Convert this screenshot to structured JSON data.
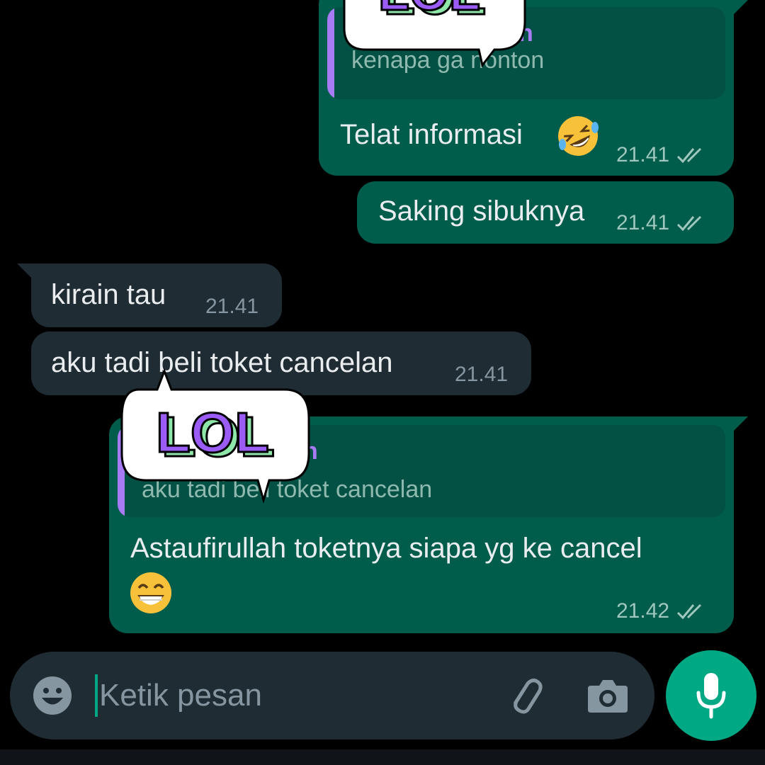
{
  "messages": [
    {
      "id": "m1",
      "direction": "outgoing",
      "quote": {
        "author": "n",
        "text": "kenapa ga nonton"
      },
      "text": "Telat informasi",
      "emoji": "rolling-on-floor-laughing",
      "time": "21.41",
      "status": "read"
    },
    {
      "id": "m2",
      "direction": "outgoing",
      "text": "Saking sibuknya",
      "time": "21.41",
      "status": "read"
    },
    {
      "id": "m3",
      "direction": "incoming",
      "text": "kirain tau",
      "time": "21.41"
    },
    {
      "id": "m4",
      "direction": "incoming",
      "text": "aku tadi beli toket cancelan",
      "time": "21.41"
    },
    {
      "id": "m5",
      "direction": "outgoing",
      "quote": {
        "author": "n",
        "text": "aku tadi beli toket cancelan"
      },
      "text": "Astaufirullah toketnya siapa yg ke cancel",
      "emoji": "grinning-face",
      "time": "21.42",
      "status": "read"
    }
  ],
  "stickers": [
    {
      "text": "LOL",
      "kind": "speech-bubble-sticker"
    },
    {
      "text": "LOL",
      "kind": "speech-bubble-sticker"
    }
  ],
  "composer": {
    "placeholder": "Ketik pesan",
    "icons": [
      "emoji-icon",
      "attach-icon",
      "camera-icon",
      "mic-icon"
    ]
  },
  "colors": {
    "outgoing_bubble": "#005c4b",
    "incoming_bubble": "#202c33",
    "quote_bar": "#a77bf3",
    "accent": "#00a884",
    "sticker_text_fill": "#9b5cf6",
    "sticker_text_shadow": "#8ee6a8"
  }
}
